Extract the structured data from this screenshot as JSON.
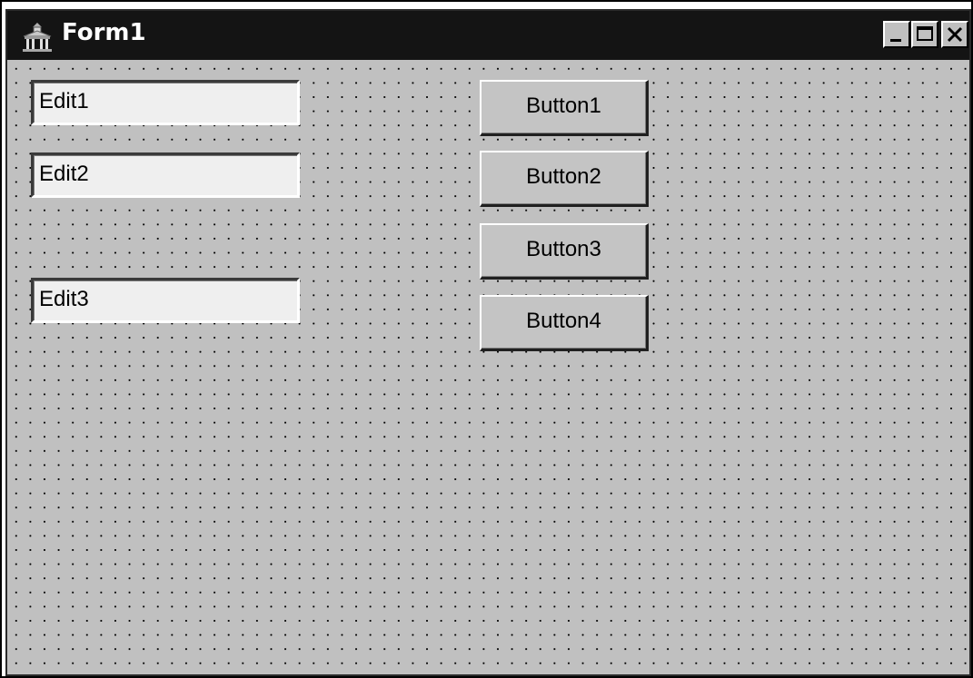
{
  "window": {
    "title": "Form1",
    "icon": "delphi-temple-icon",
    "caption_buttons": [
      "minimize-icon",
      "maximize-icon",
      "close-icon"
    ]
  },
  "edits": [
    {
      "value": "Edit1"
    },
    {
      "value": "Edit2"
    },
    {
      "value": "Edit3"
    }
  ],
  "buttons": [
    {
      "label": "Button1"
    },
    {
      "label": "Button2"
    },
    {
      "label": "Button3"
    },
    {
      "label": "Button4"
    }
  ],
  "colors": {
    "titlebar": "#141414",
    "form_background": "#c0c0c0",
    "grid_dots": "#000000"
  }
}
